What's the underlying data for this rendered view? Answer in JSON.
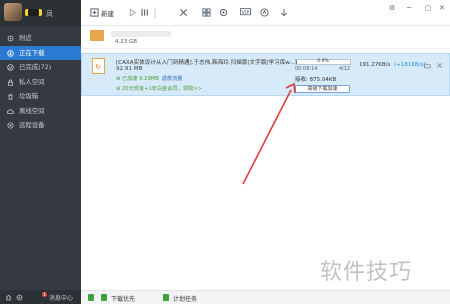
{
  "profile": {
    "name": "凤"
  },
  "toolbar": {
    "new_label": "新建",
    "vip_label": "VIP"
  },
  "sidebar": {
    "items": [
      {
        "label": "附近",
        "icon": "location-icon",
        "active": false
      },
      {
        "label": "正在下载",
        "icon": "download-icon",
        "active": true
      },
      {
        "label": "已完成(72)",
        "icon": "check-icon",
        "active": false
      },
      {
        "label": "私人空间",
        "icon": "lock-icon",
        "active": false
      },
      {
        "label": "垃圾箱",
        "icon": "trash-icon",
        "active": false
      },
      {
        "label": "离线空间",
        "icon": "cloud-icon",
        "active": false
      },
      {
        "label": "远程设备",
        "icon": "device-icon",
        "active": false
      }
    ],
    "bottom": {
      "notification_count": "1",
      "message_label": "消息中心"
    }
  },
  "downloads": {
    "row0": {
      "size": "4.23 GB"
    },
    "row1": {
      "name": "[CAXA实体设计从入门到精通].于志伟,韩海玲.扫描版(文字版[学习库w...",
      "size": "92.91 MB",
      "speedup_text": "已加速 9.29MB",
      "speedup_link": "退款流量",
      "promo_text": "20元现金+1年白金会员，领取>>",
      "progress_pct": "0.9%",
      "progress_value": 0.009,
      "remaining": "00:08:14",
      "ratio": "4/12",
      "speed_label": "接收: 875.04KB",
      "accelerate_button": "高级下载加速",
      "rate_main": "191.27KB/s",
      "rate_extra": "(+181KB/s)"
    }
  },
  "statusbar": {
    "item1": "下载优先",
    "item2": "计划任务"
  },
  "watermark": "软件技巧",
  "colors": {
    "sidebar": "#343a40",
    "active": "#2a7ad2",
    "selected_row": "#d7eaf9",
    "arrow": "#e03c3c"
  }
}
